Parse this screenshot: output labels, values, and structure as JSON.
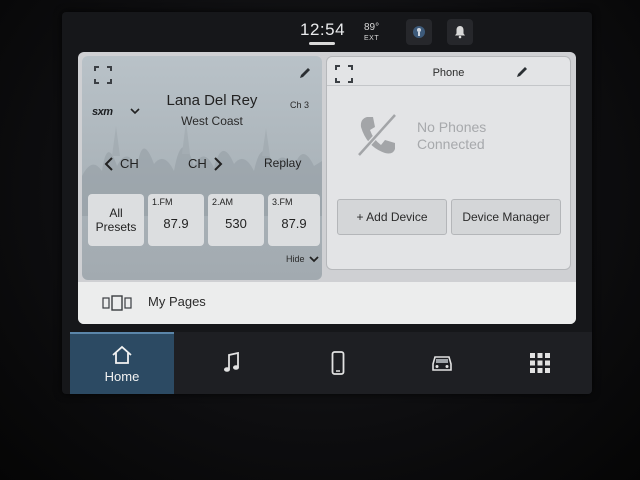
{
  "status": {
    "time": "12:54",
    "temperature": "89°",
    "temperature_unit": "EXT",
    "icons": [
      "voice-assist-icon",
      "notification-bell-icon"
    ]
  },
  "radio": {
    "source": "sxm",
    "artist": "Lana Del Rey",
    "song": "West Coast",
    "channel": "Ch 3",
    "prev_label": "CH",
    "next_label": "CH",
    "replay_label": "Replay",
    "all_presets_line1": "All",
    "all_presets_line2": "Presets",
    "presets": [
      {
        "label": "1.FM",
        "freq": "87.9"
      },
      {
        "label": "2.AM",
        "freq": "530"
      },
      {
        "label": "3.FM",
        "freq": "87.9"
      }
    ],
    "hide_label": "Hide"
  },
  "phone": {
    "title": "Phone",
    "status_line1": "No Phones",
    "status_line2": "Connected",
    "add_device_label": "+ Add Device",
    "device_manager_label": "Device Manager"
  },
  "mypages": {
    "label": "My Pages"
  },
  "nav": {
    "home_label": "Home",
    "items": [
      "home-icon",
      "music-note-icon",
      "phone-icon",
      "vehicle-icon",
      "apps-grid-icon"
    ]
  },
  "colors": {
    "accent": "#2c4a63",
    "panel": "#cfd0d3",
    "navbar": "#1e1f23"
  }
}
